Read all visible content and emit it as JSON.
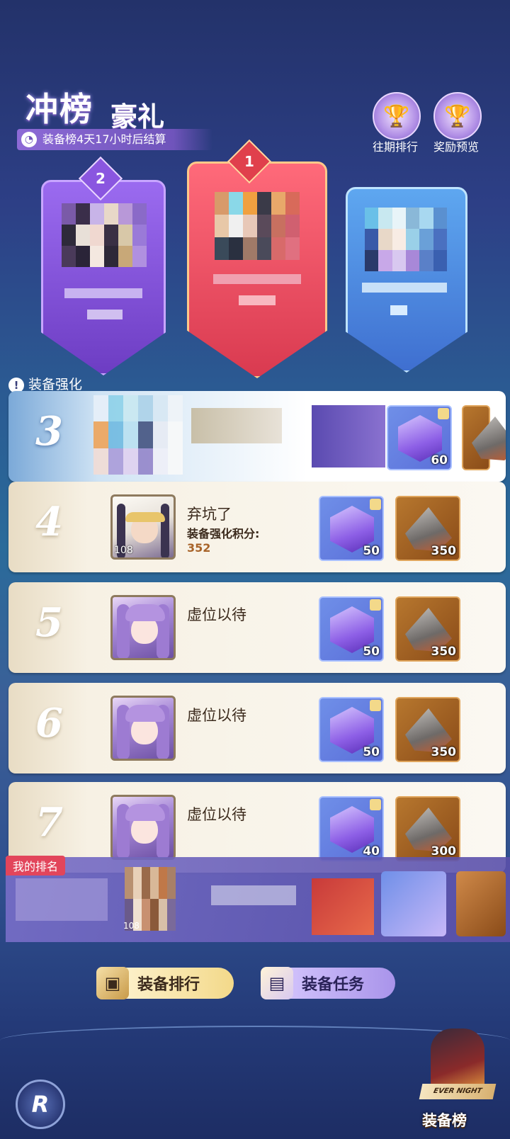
{
  "header": {
    "title_main": "冲榜",
    "title_sub": "豪礼",
    "countdown": "装备榜4天17小时后结算",
    "buttons": [
      {
        "label": "往期排行",
        "icon": "trophy-icon"
      },
      {
        "label": "奖励预览",
        "icon": "trophy-icon"
      }
    ]
  },
  "podium": {
    "first_badge": "1",
    "second_badge": "2"
  },
  "notice": {
    "text": "装备强化"
  },
  "rows": [
    {
      "rank": "3",
      "name": "",
      "score_label": "",
      "score": "",
      "items": [
        {
          "qty": "60"
        },
        {
          "qty": ""
        }
      ]
    },
    {
      "rank": "4",
      "level": "108",
      "name": "弃坑了",
      "score_label": "装备强化积分:",
      "score": "352",
      "items": [
        {
          "qty": "50"
        },
        {
          "qty": "350"
        }
      ]
    },
    {
      "rank": "5",
      "name": "虚位以待",
      "items": [
        {
          "qty": "50"
        },
        {
          "qty": "350"
        }
      ]
    },
    {
      "rank": "6",
      "name": "虚位以待",
      "items": [
        {
          "qty": "50"
        },
        {
          "qty": "350"
        }
      ]
    },
    {
      "rank": "7",
      "name": "虚位以待",
      "items": [
        {
          "qty": "40"
        },
        {
          "qty": "300"
        }
      ]
    }
  ],
  "my_rank": {
    "tag": "我的排名",
    "level": "108"
  },
  "bottom": {
    "equip_rank_button": "装备排行",
    "equip_task_button": "装备任务",
    "logo_letter": "R",
    "rank_icon_label": "装备榜",
    "rank_icon_sublabel": "EVER NIGHT"
  },
  "colors": {
    "rank1": "#d93a50",
    "rank2": "#6d3dc3",
    "rank3": "#3f6fd0",
    "my_rank_tag": "#e2455b"
  }
}
